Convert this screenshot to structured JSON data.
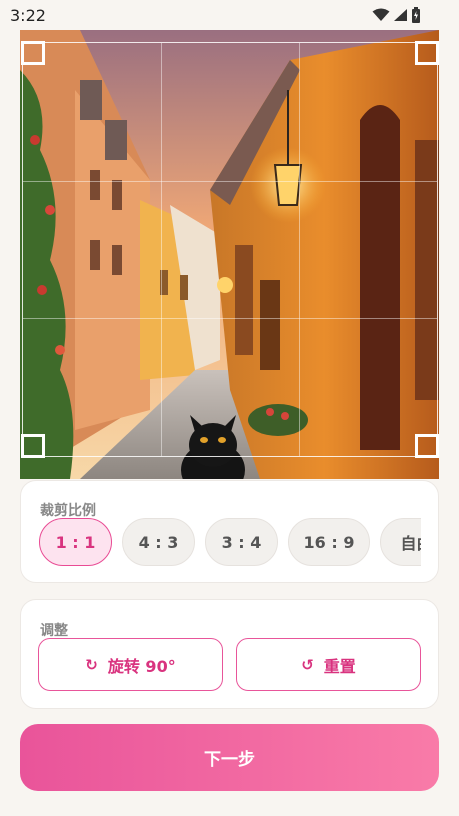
{
  "status_bar": {
    "time": "3:22"
  },
  "ratio_card": {
    "title": "裁剪比例",
    "options": [
      {
        "label": "1 : 1",
        "selected": true
      },
      {
        "label": "4 : 3",
        "selected": false
      },
      {
        "label": "3 : 4",
        "selected": false
      },
      {
        "label": "16 : 9",
        "selected": false
      },
      {
        "label": "自由",
        "selected": false
      }
    ]
  },
  "adjust_card": {
    "title": "调整",
    "rotate_label": "旋转 90°",
    "reset_label": "重置",
    "rotate_icon": "rotate-icon",
    "reset_icon": "reset-icon"
  },
  "next_button": {
    "label": "下一步"
  },
  "colors": {
    "accent": "#e94b94",
    "accent_light": "#fde3ef",
    "background": "#f8f5f1"
  }
}
